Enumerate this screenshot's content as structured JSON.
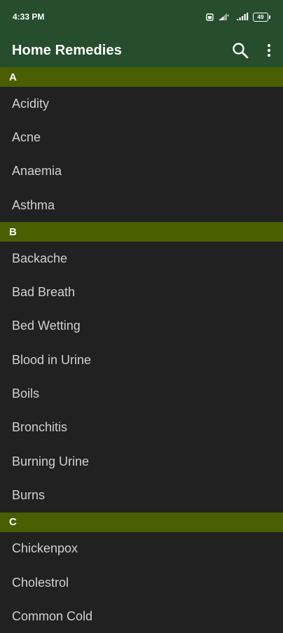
{
  "status_bar": {
    "time": "4:33 PM",
    "battery": "49"
  },
  "app_bar": {
    "title": "Home Remedies"
  },
  "sections": [
    {
      "letter": "A",
      "items": [
        "Acidity",
        "Acne",
        "Anaemia",
        "Asthma"
      ]
    },
    {
      "letter": "B",
      "items": [
        "Backache",
        "Bad Breath",
        "Bed Wetting",
        "Blood in Urine",
        "Boils",
        "Bronchitis",
        "Burning Urine",
        "Burns"
      ]
    },
    {
      "letter": "C",
      "items": [
        "Chickenpox",
        "Cholestrol",
        "Common Cold"
      ]
    }
  ]
}
